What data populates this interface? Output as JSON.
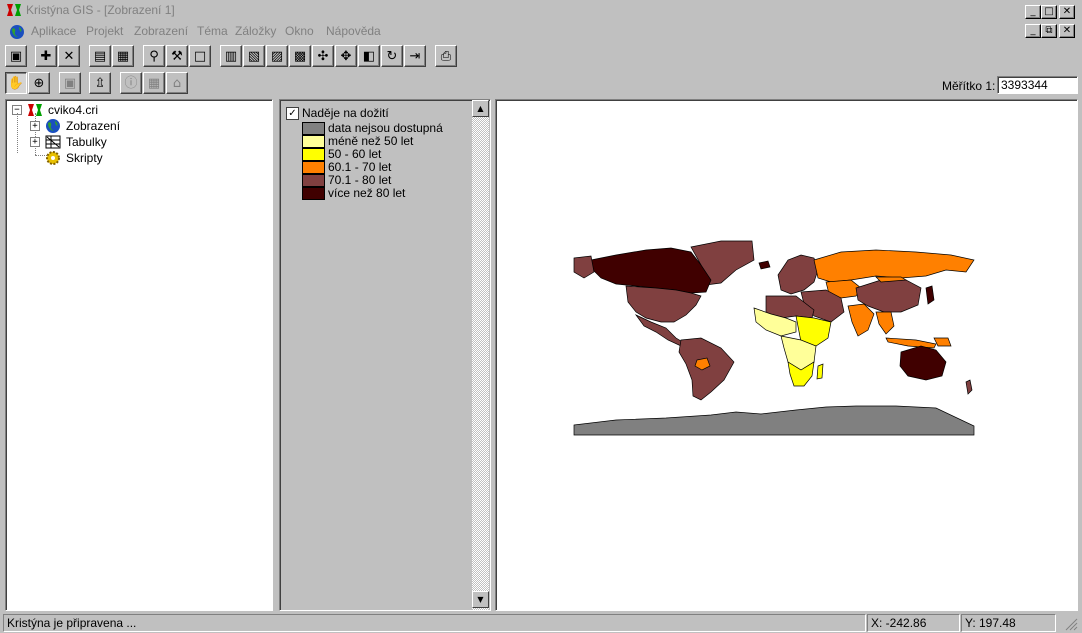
{
  "window": {
    "title": "Kristýna GIS - [Zobrazení 1]",
    "app_controls": [
      "_",
      "□",
      "✕"
    ],
    "doc_controls": [
      "_",
      "⧉",
      "✕"
    ]
  },
  "menu": {
    "items": [
      "Aplikace",
      "Projekt",
      "Zobrazení",
      "Téma",
      "Záložky",
      "Okno",
      "Nápověda"
    ]
  },
  "toolbar1": {
    "buttons": [
      {
        "icon": "new-view-icon",
        "glyph": "▣"
      },
      {
        "icon": "add-theme-icon",
        "glyph": "✚"
      },
      {
        "icon": "delete-theme-icon",
        "glyph": "✕"
      },
      {
        "icon": "theme-properties-icon",
        "glyph": "▤"
      },
      {
        "icon": "table-icon",
        "glyph": "▦"
      },
      {
        "icon": "find-icon",
        "glyph": "⚲"
      },
      {
        "icon": "query-builder-icon",
        "glyph": "⚒"
      },
      {
        "icon": "clear-selection-icon",
        "glyph": "□"
      },
      {
        "icon": "legend-editor-icon",
        "glyph": "▥"
      },
      {
        "icon": "edit-legend-icon",
        "glyph": "▧"
      },
      {
        "icon": "layer-up-icon",
        "glyph": "▨"
      },
      {
        "icon": "layer-down-icon",
        "glyph": "▩"
      },
      {
        "icon": "zoom-to-full-extent-icon",
        "glyph": "✣"
      },
      {
        "icon": "zoom-to-active-themes-icon",
        "glyph": "✥"
      },
      {
        "icon": "zoom-previous-icon",
        "glyph": "◧"
      },
      {
        "icon": "refresh-icon",
        "glyph": "↻"
      },
      {
        "icon": "zoom-to-selected-icon",
        "glyph": "⇥"
      },
      {
        "icon": "print-icon",
        "glyph": "⎙"
      }
    ]
  },
  "toolbar2": {
    "buttons": [
      {
        "icon": "pan-hand-icon",
        "glyph": "✋",
        "pressed": true
      },
      {
        "icon": "zoom-in-icon",
        "glyph": "⊕"
      },
      {
        "icon": "select-feature-icon",
        "glyph": "▣",
        "disabled": true
      },
      {
        "icon": "identify-icon",
        "glyph": "⇫"
      },
      {
        "icon": "info-icon",
        "glyph": "ⓘ",
        "disabled": true
      },
      {
        "icon": "measure-icon",
        "glyph": "▦",
        "disabled": true
      },
      {
        "icon": "hotlink-icon",
        "glyph": "⌂",
        "disabled": true
      }
    ]
  },
  "scale": {
    "label": "Měřítko 1:",
    "value": "3393344"
  },
  "project_tree": {
    "root": "cviko4.cri",
    "children": [
      "Zobrazení",
      "Tabulky",
      "Skripty"
    ]
  },
  "legend": {
    "checked": true,
    "title": "Naděje na dožití",
    "classes": [
      {
        "label": "data nejsou dostupná",
        "color": "#808080"
      },
      {
        "label": "méně než 50 let",
        "color": "#ffff99"
      },
      {
        "label": "50 - 60 let",
        "color": "#ffff00"
      },
      {
        "label": "60.1 - 70 let",
        "color": "#ff8000"
      },
      {
        "label": "70.1 - 80 let",
        "color": "#804040"
      },
      {
        "label": "více než 80 let",
        "color": "#400000"
      }
    ]
  },
  "status": {
    "message": "Kristýna je připravena ...",
    "x": "X: -242.86",
    "y": "Y: 197.48"
  }
}
